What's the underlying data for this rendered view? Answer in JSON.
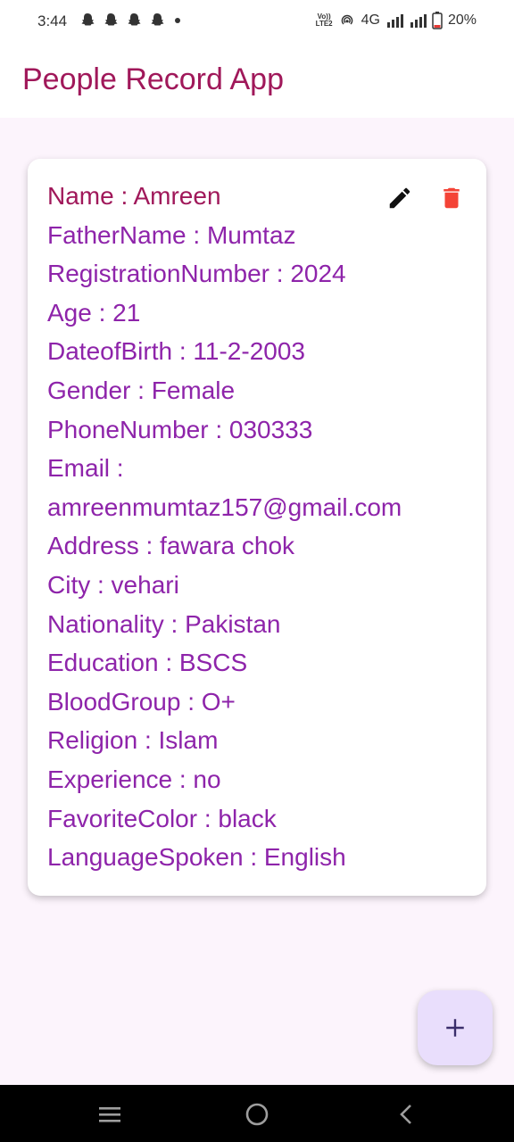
{
  "status_bar": {
    "time": "3:44",
    "left_icons": [
      "snapchat-icon",
      "snapchat-icon",
      "snapchat-icon",
      "snapchat-icon",
      "dot-icon"
    ],
    "volte_label_1": "Vo))",
    "volte_label_2": "LTE2",
    "network_label": "4G",
    "battery": "20%"
  },
  "app_bar": {
    "title": "People Record App"
  },
  "record": {
    "lines": [
      "Name : Amreen",
      "FatherName : Mumtaz",
      "RegistrationNumber : 2024",
      "Age :  21",
      "DateofBirth : 11-2-2003",
      "Gender : Female",
      "PhoneNumber : 030333",
      "Email :",
      "amreenmumtaz157@gmail.com",
      "Address : fawara chok",
      "City : vehari",
      "Nationality : Pakistan",
      "Education : BSCS",
      "BloodGroup : O+",
      "Religion : Islam",
      "Experience : no",
      "FavoriteColor : black",
      "LanguageSpoken : English"
    ],
    "actions": {
      "edit_icon": "pencil-icon",
      "delete_icon": "trash-icon"
    }
  },
  "fab": {
    "icon": "plus-icon"
  },
  "nav_bar": {
    "icons": [
      "menu-icon",
      "home-icon",
      "back-icon"
    ]
  },
  "colors": {
    "title": "#a0185a",
    "field_text": "#8e24aa",
    "delete": "#f44336",
    "fab_bg": "#e9defc",
    "background": "#fcf4fc"
  }
}
